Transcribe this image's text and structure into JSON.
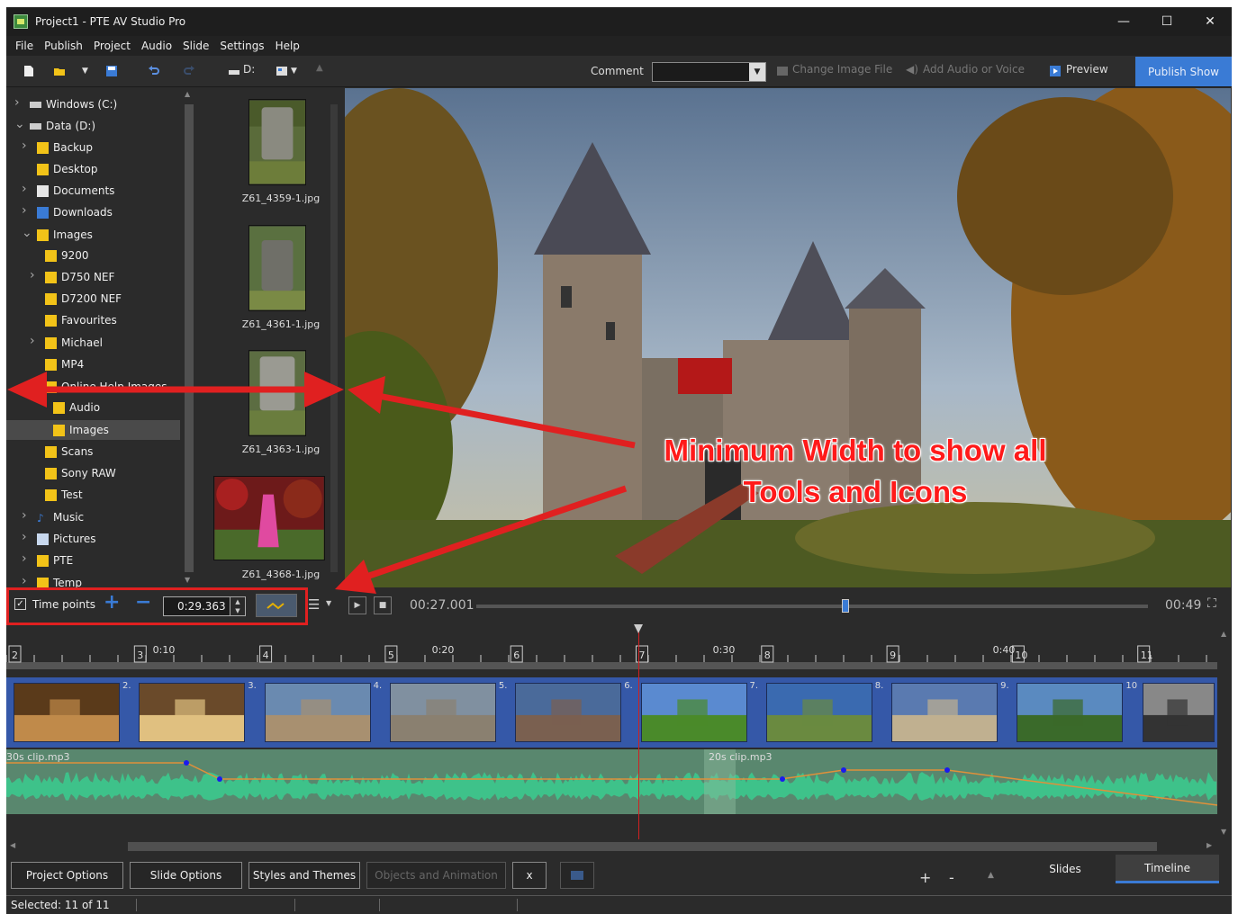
{
  "window": {
    "title": "Project1 - PTE AV Studio Pro",
    "min": "—",
    "max": "☐",
    "close": "✕"
  },
  "menu": [
    "File",
    "Publish",
    "Project",
    "Audio",
    "Slide",
    "Settings",
    "Help"
  ],
  "toolbar": {
    "drive": "D:",
    "comment_label": "Comment",
    "comment_value": "",
    "change_image": "Change Image File",
    "add_audio": "Add Audio or Voice",
    "preview": "Preview",
    "publish": "Publish Show"
  },
  "tree": [
    {
      "label": "Windows (C:)",
      "icon": "drive-icon"
    },
    {
      "label": "Data (D:)",
      "icon": "drive-icon"
    },
    {
      "label": "Backup",
      "icon": "folder-icon"
    },
    {
      "label": "Desktop",
      "icon": "folder-icon"
    },
    {
      "label": "Documents",
      "icon": "documents-icon"
    },
    {
      "label": "Downloads",
      "icon": "downloads-icon"
    },
    {
      "label": "Images",
      "icon": "folder-icon"
    },
    {
      "label": "9200",
      "icon": "folder-icon"
    },
    {
      "label": "D750 NEF",
      "icon": "folder-icon"
    },
    {
      "label": "D7200 NEF",
      "icon": "folder-icon"
    },
    {
      "label": "Favourites",
      "icon": "folder-icon"
    },
    {
      "label": "Michael",
      "icon": "folder-icon"
    },
    {
      "label": "MP4",
      "icon": "folder-icon"
    },
    {
      "label": "Online Help Images",
      "icon": "folder-icon"
    },
    {
      "label": "Audio",
      "icon": "folder-icon"
    },
    {
      "label": "Images",
      "icon": "folder-icon"
    },
    {
      "label": "Scans",
      "icon": "folder-icon"
    },
    {
      "label": "Sony RAW",
      "icon": "folder-icon"
    },
    {
      "label": "Test",
      "icon": "folder-icon"
    },
    {
      "label": "Music",
      "icon": "music-icon"
    },
    {
      "label": "Pictures",
      "icon": "pictures-icon"
    },
    {
      "label": "PTE",
      "icon": "folder-icon"
    },
    {
      "label": "Temp",
      "icon": "folder-icon"
    }
  ],
  "thumbnails": [
    "Z61_4359-1.jpg",
    "Z61_4361-1.jpg",
    "Z61_4363-1.jpg",
    "Z61_4368-1.jpg"
  ],
  "controls": {
    "time_points": "Time points",
    "time_value": "0:29.363",
    "current_time": "00:27.001",
    "total_time": "00:49",
    "position": 0.55
  },
  "ruler": {
    "labels": [
      "0:10",
      "0:20",
      "0:30",
      "0:40"
    ],
    "markers": [
      "2",
      "3",
      "4",
      "5",
      "6",
      "7",
      "8",
      "9",
      "10",
      "11"
    ]
  },
  "slide_nums": [
    "2.",
    "3.",
    "4.",
    "5.",
    "6.",
    "7.",
    "8.",
    "9.",
    "10"
  ],
  "audio": {
    "clip1": "30s clip.mp3",
    "clip2": "20s clip.mp3"
  },
  "bottom": {
    "project_options": "Project Options",
    "slide_options": "Slide Options",
    "styles": "Styles and Themes",
    "objects": "Objects and Animation",
    "x": "x",
    "plus": "+",
    "minus": "-",
    "tab_slides": "Slides",
    "tab_timeline": "Timeline"
  },
  "status": "Selected: 11 of 11",
  "annotation": {
    "line1": "Minimum Width to show all",
    "line2": "Tools and Icons",
    "color": "#e02020"
  }
}
